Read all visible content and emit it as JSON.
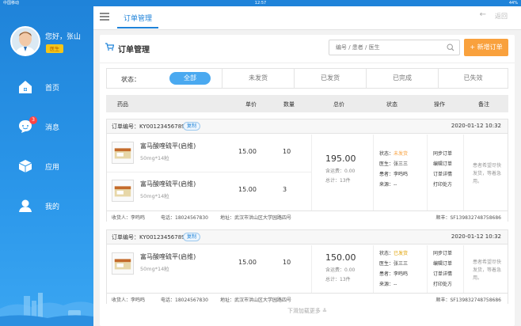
{
  "statusbar": {
    "carrier": "中国移动",
    "time": "12:57",
    "battery": "44%"
  },
  "user": {
    "greeting": "您好，张山",
    "role": "医生"
  },
  "nav": [
    {
      "label": "首页",
      "icon": "home-icon"
    },
    {
      "label": "消息",
      "icon": "message-icon",
      "badge": "3"
    },
    {
      "label": "应用",
      "icon": "cube-icon"
    },
    {
      "label": "我的",
      "icon": "user-icon"
    }
  ],
  "topbar": {
    "title": "订单管理",
    "back": "返回"
  },
  "panel": {
    "title": "订单管理",
    "search_placeholder": "编号 / 患者 / 医生",
    "add_button": "+ 新增订单"
  },
  "filter": {
    "label": "状态：",
    "tabs": [
      "全部",
      "未发货",
      "已发货",
      "已完成",
      "已失效"
    ],
    "active": "全部"
  },
  "table_header": [
    "药品",
    "单价",
    "数量",
    "总价",
    "状态",
    "操作",
    "备注"
  ],
  "orders": [
    {
      "no": "订单编号：KY00123456789",
      "copy": "复制",
      "date": "2020-01-12  10:32",
      "items": [
        {
          "name": "富马酸喹硫平(启维)",
          "spec": "50mg*14粒",
          "price": "15.00",
          "qty": "10"
        },
        {
          "name": "富马酸喹硫平(启维)",
          "spec": "50mg*14粒",
          "price": "15.00",
          "qty": "3"
        }
      ],
      "total": "195.00",
      "shipping": "含运费：0.00",
      "count": "总计：13件",
      "status_label": "状态：",
      "status": "未发货",
      "doctor": "医生：张三三",
      "patient": "患者：李鸣鸣",
      "source": "来源：--",
      "actions": [
        "同步订单",
        "编辑订单",
        "订单详情",
        "打印处方"
      ],
      "remark": "患者希望尽快发货，等着急用。",
      "receiver": "收货人：李鸣鸣",
      "phone": "电话：18024567830",
      "address": "地址：武汉市洪山区大学园路四号",
      "waybill": "顺丰：SF1398327487586​86"
    },
    {
      "no": "订单编号：KY00123456789",
      "copy": "复制",
      "date": "2020-01-12  10:32",
      "items": [
        {
          "name": "富马酸喹硫平(启维)",
          "spec": "50mg*14粒",
          "price": "15.00",
          "qty": "10"
        }
      ],
      "total": "150.00",
      "shipping": "含运费：0.00",
      "count": "总计：13件",
      "status_label": "状态：",
      "status": "已发货",
      "doctor": "医生：张三三",
      "patient": "患者：李鸣鸣",
      "source": "来源：--",
      "actions": [
        "同步订单",
        "编辑订单",
        "订单详情",
        "打印处方"
      ],
      "remark": "患者希望尽快发货，等着急用。",
      "receiver": "收货人：李鸣鸣",
      "phone": "电话：18024567830",
      "address": "地址：武汉市洪山区大学园路四号",
      "waybill": "顺丰：SF1398327487586​86"
    }
  ],
  "load_more": "下滑加载更多",
  "colors": {
    "primary": "#1f83d9",
    "accent": "#f9a13d",
    "unshipped": "#f9a13d",
    "shipped": "#e0a100"
  }
}
